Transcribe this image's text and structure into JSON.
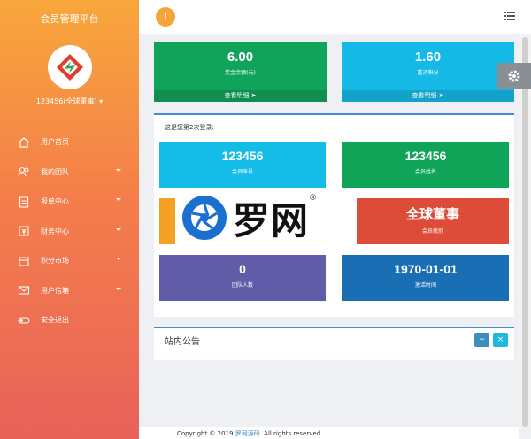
{
  "sidebar": {
    "brand": "会员管理平台",
    "user": "123456(全球董事)",
    "items": [
      {
        "label": "用户首页",
        "icon": "home-icon",
        "caret": false
      },
      {
        "label": "我的团队",
        "icon": "team-icon",
        "caret": true
      },
      {
        "label": "报单中心",
        "icon": "clipboard-icon",
        "caret": true
      },
      {
        "label": "财务中心",
        "icon": "finance-icon",
        "caret": true
      },
      {
        "label": "积分市场",
        "icon": "market-icon",
        "caret": true
      },
      {
        "label": "用户信箱",
        "icon": "mail-icon",
        "caret": true
      },
      {
        "label": "安全退出",
        "icon": "logout-icon",
        "caret": false
      }
    ]
  },
  "topbar": {
    "notification_count": "!"
  },
  "cards_top": [
    {
      "value": "6.00",
      "label": "奖金余额(元)",
      "more": "查看明细",
      "color": "#10a35a"
    },
    {
      "value": "1.60",
      "label": "重消积分",
      "more": "查看明细",
      "color": "#15b9e6"
    }
  ],
  "login_text": "这是您第2次登录:",
  "info_tiles": [
    {
      "value": "123456",
      "label": "会员账号",
      "color": "#14bde8"
    },
    {
      "value": "123456",
      "label": "会员姓名",
      "color": "#0fa458"
    },
    {
      "value": "",
      "label": "",
      "color": "#f5a224"
    },
    {
      "value": "全球董事",
      "label": "会员级别",
      "color": "#dd4b39"
    },
    {
      "value": "0",
      "label": "团队人数",
      "color": "#605ca8"
    },
    {
      "value": "1970-01-01",
      "label": "激活时间",
      "color": "#1a6fb4"
    }
  ],
  "notice": {
    "title": "站内公告",
    "minimize": "−",
    "close": "×"
  },
  "watermark": {
    "text": "罗网",
    "mark": "®"
  },
  "footer": {
    "prefix": "Copyright © 2019 ",
    "link": "罗网源码",
    "suffix": ". All rights reserved."
  },
  "colors": {
    "accent": "#3f8fd0",
    "sidebar_top": "#f8a73c",
    "sidebar_bottom": "#e8625a"
  }
}
